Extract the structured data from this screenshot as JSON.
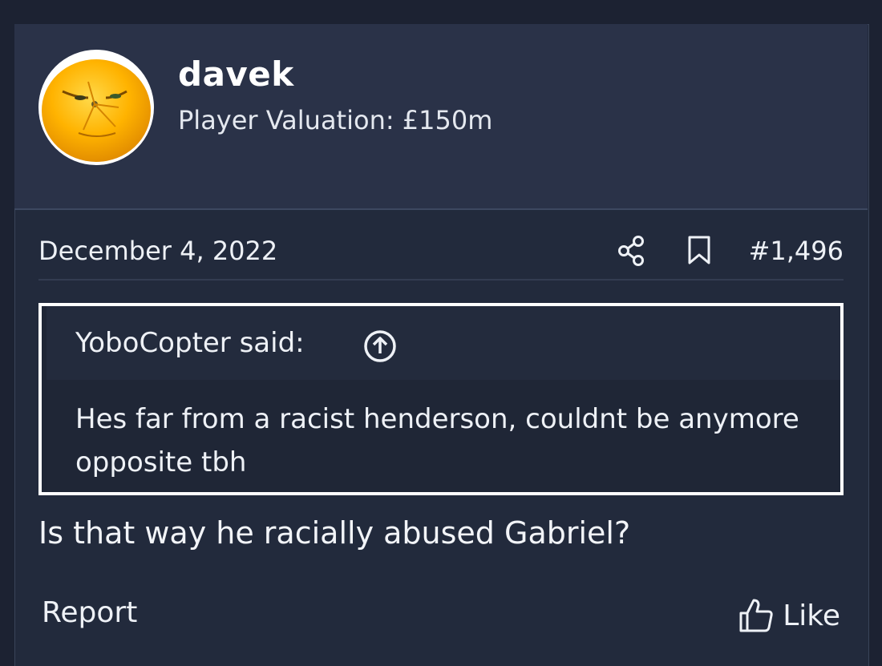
{
  "user": {
    "name": "davek",
    "title": "Player Valuation: £150m",
    "avatar_icon": "orange-face-avatar"
  },
  "post": {
    "date": "December 4, 2022",
    "number": "#1,496",
    "share_icon": "share-icon",
    "bookmark_icon": "bookmark-icon",
    "quote": {
      "author_label": "YoboCopter said:",
      "jump_icon": "arrow-up-circle-icon",
      "text": "Hes far from a racist henderson, couldnt be anymore opposite tbh"
    },
    "body": "Is that way he racially abused Gabriel?"
  },
  "actions": {
    "report_label": "Report",
    "like_label": "Like",
    "like_icon": "thumbs-up-icon"
  },
  "colors": {
    "page_bg": "#1c2232",
    "header_bg": "#2a3248",
    "quote_border": "#ffffff",
    "text": "#eef1f6"
  }
}
